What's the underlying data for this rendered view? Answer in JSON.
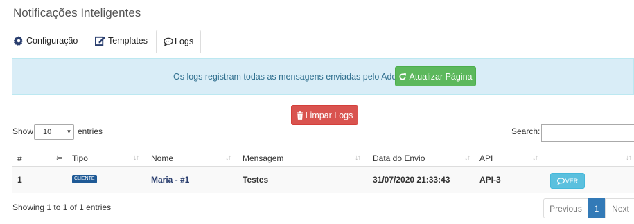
{
  "page": {
    "title": "Notificações Inteligentes"
  },
  "tabs": [
    {
      "label": "Configuração",
      "icon": "gear-icon"
    },
    {
      "label": "Templates",
      "icon": "edit-icon"
    },
    {
      "label": "Logs",
      "icon": "comment-icon",
      "active": true
    }
  ],
  "alert": {
    "text": "Os logs registram todas as mensagens enviadas pelo Addon.",
    "refresh_label": "Atualizar Página"
  },
  "clear_logs_label": "Limpar Logs",
  "length_control": {
    "prefix": "Show",
    "value": "10",
    "suffix": "entries"
  },
  "search": {
    "label": "Search:",
    "value": ""
  },
  "table": {
    "columns": [
      "#",
      "Tipo",
      "Nome",
      "Mensagem",
      "Data do Envio",
      "API",
      ""
    ],
    "rows": [
      {
        "id": "1",
        "tipo": "CLIENTE",
        "nome": "Maria - #1",
        "mensagem": "Testes",
        "data": "31/07/2020 21:33:43",
        "api": "API-3",
        "action_label": "VER"
      }
    ]
  },
  "info": "Showing 1 to 1 of 1 entries",
  "pagination": {
    "previous": "Previous",
    "current": "1",
    "next": "Next"
  },
  "colors": {
    "alert_bg": "#d9edf7",
    "success": "#5cb85c",
    "danger": "#d9534f",
    "info": "#5bc0de",
    "primary": "#337ab7",
    "badge": "#1f5a96"
  }
}
